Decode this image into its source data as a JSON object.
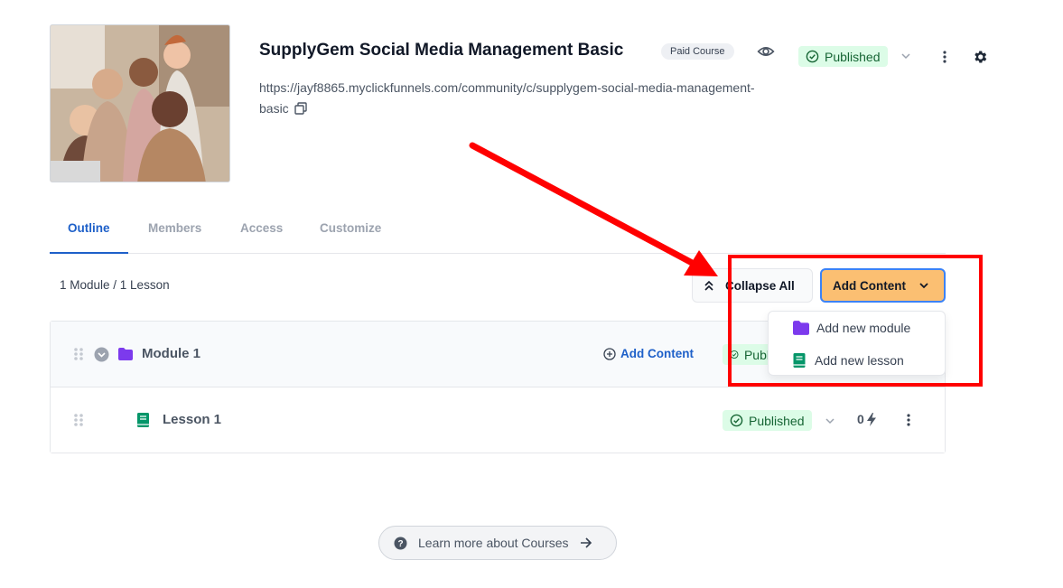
{
  "course": {
    "title": "SupplyGem Social Media Management Basic",
    "badge": "Paid Course",
    "status": "Published",
    "url": "https://jayf8865.myclickfunnels.com/community/c/supplygem-social-media-management-basic"
  },
  "tabs": [
    {
      "label": "Outline",
      "active": true
    },
    {
      "label": "Members",
      "active": false
    },
    {
      "label": "Access",
      "active": false
    },
    {
      "label": "Customize",
      "active": false
    }
  ],
  "toolbar": {
    "summary": "1 Module / 1 Lesson",
    "collapse_label": "Collapse All",
    "add_content_label": "Add Content"
  },
  "dropdown": {
    "items": [
      {
        "label": "Add new module",
        "icon": "folder-icon"
      },
      {
        "label": "Add new lesson",
        "icon": "book-icon"
      }
    ]
  },
  "outline": {
    "module": {
      "label": "Module 1",
      "add_label": "Add Content",
      "status": "Publ"
    },
    "lesson": {
      "label": "Lesson 1",
      "status": "Published",
      "count": "0"
    }
  },
  "footer": {
    "learn_label": "Learn more about Courses"
  },
  "colors": {
    "accent_blue": "#1e60c9",
    "published_bg": "#dcfce7",
    "published_text": "#166534",
    "add_button_bg": "#fbbf72",
    "folder_purple": "#7c3aed",
    "book_green": "#059669",
    "annotation_red": "#ff0000"
  }
}
